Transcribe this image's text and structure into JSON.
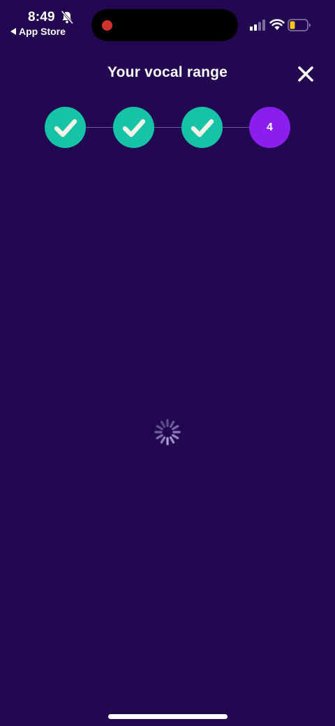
{
  "status_bar": {
    "time": "8:49",
    "back_label": "App Store",
    "icons": [
      "bell-slash-icon",
      "cellular-signal-icon",
      "wifi-icon",
      "battery-icon"
    ]
  },
  "header": {
    "title": "Your vocal range",
    "close_icon": "close-icon"
  },
  "stepper": {
    "steps": [
      {
        "state": "done",
        "icon": "checkmark-icon"
      },
      {
        "state": "done",
        "icon": "checkmark-icon"
      },
      {
        "state": "done",
        "icon": "checkmark-icon"
      },
      {
        "state": "current",
        "label": "4"
      }
    ]
  },
  "main": {
    "loading_icon": "spinner-icon"
  },
  "colors": {
    "background": "#210851",
    "step_done": "#16c3a6",
    "step_current": "#8a1eef",
    "record_dot": "#d0342c",
    "battery_level": "#f5c518"
  }
}
